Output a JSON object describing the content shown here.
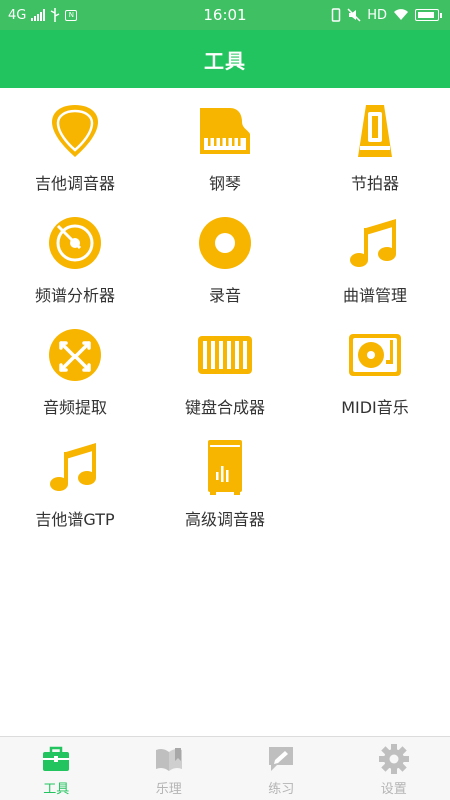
{
  "status_bar": {
    "network": "4G",
    "time": "16:01",
    "hd": "HD",
    "nfc_box": "N"
  },
  "header": {
    "title": "工具"
  },
  "tools": [
    {
      "label": "吉他调音器",
      "icon": "guitar-pick-icon"
    },
    {
      "label": "钢琴",
      "icon": "piano-icon"
    },
    {
      "label": "节拍器",
      "icon": "metronome-icon"
    },
    {
      "label": "频谱分析器",
      "icon": "disc-analyzer-icon"
    },
    {
      "label": "录音",
      "icon": "record-disc-icon"
    },
    {
      "label": "曲谱管理",
      "icon": "music-note-icon"
    },
    {
      "label": "音频提取",
      "icon": "audio-extract-icon"
    },
    {
      "label": "键盘合成器",
      "icon": "keyboard-synth-icon"
    },
    {
      "label": "MIDI音乐",
      "icon": "turntable-icon"
    },
    {
      "label": "吉他谱GTP",
      "icon": "music-note-icon"
    },
    {
      "label": "高级调音器",
      "icon": "advanced-tuner-icon"
    }
  ],
  "tabs": [
    {
      "label": "工具",
      "icon": "toolbox-icon",
      "active": true
    },
    {
      "label": "乐理",
      "icon": "book-icon",
      "active": false
    },
    {
      "label": "练习",
      "icon": "edit-icon",
      "active": false
    },
    {
      "label": "设置",
      "icon": "gear-icon",
      "active": false
    }
  ],
  "colors": {
    "accent": "#22c45f",
    "status_bar": "#3fc163",
    "icon": "#f7b500",
    "tab_inactive": "#b5b5b5"
  }
}
